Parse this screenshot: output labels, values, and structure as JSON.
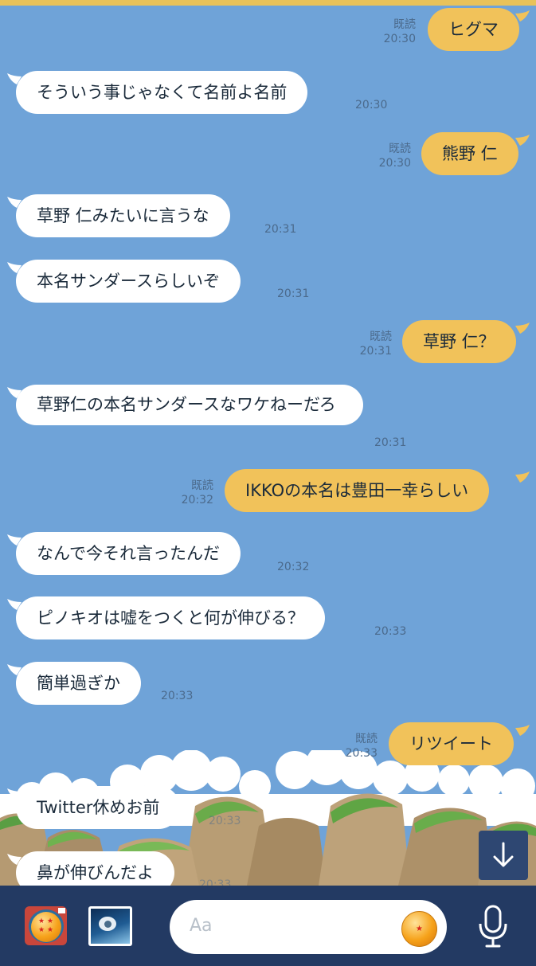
{
  "messages": [
    {
      "side": "out",
      "text": "ヒグマ",
      "read": "既読",
      "time": "20:30"
    },
    {
      "side": "in",
      "text": "そういう事じゃなくて名前よ名前",
      "time": "20:30"
    },
    {
      "side": "out",
      "text": "熊野 仁",
      "read": "既読",
      "time": "20:30"
    },
    {
      "side": "in",
      "text": "草野 仁みたいに言うな",
      "time": "20:31"
    },
    {
      "side": "in",
      "text": "本名サンダースらしいぞ",
      "time": "20:31"
    },
    {
      "side": "out",
      "text": "草野 仁？",
      "read": "既読",
      "time": "20:31"
    },
    {
      "side": "in",
      "text": "草野仁の本名サンダースなワケねーだろ",
      "time": "20:31"
    },
    {
      "side": "out",
      "text": "IKKOの本名は豊田一幸らしい",
      "read": "既読",
      "time": "20:32"
    },
    {
      "side": "in",
      "text": "なんで今それ言ったんだ",
      "time": "20:32"
    },
    {
      "side": "in",
      "text": "ピノキオは嘘をつくと何が伸びる？",
      "time": "20:33"
    },
    {
      "side": "in",
      "text": "簡単過ぎか",
      "time": "20:33"
    },
    {
      "side": "out",
      "text": "リツイート",
      "read": "既読",
      "time": "20:33"
    },
    {
      "side": "in",
      "text": "Twitter休めお前",
      "time": "20:33"
    },
    {
      "side": "in",
      "text": "鼻が伸びんだよ",
      "time": "20:33"
    }
  ],
  "input": {
    "placeholder": "Aa"
  },
  "icons": {
    "camera": "dragon-ball-camera-icon",
    "gallery": "photo-gallery-icon",
    "sticker": "dragon-ball-sticker-icon",
    "mic": "microphone-icon",
    "scroll_down": "arrow-down-icon"
  },
  "colors": {
    "background": "#6fa3d8",
    "incoming": "#ffffff",
    "outgoing": "#f1c25a",
    "bar": "#233a63"
  }
}
